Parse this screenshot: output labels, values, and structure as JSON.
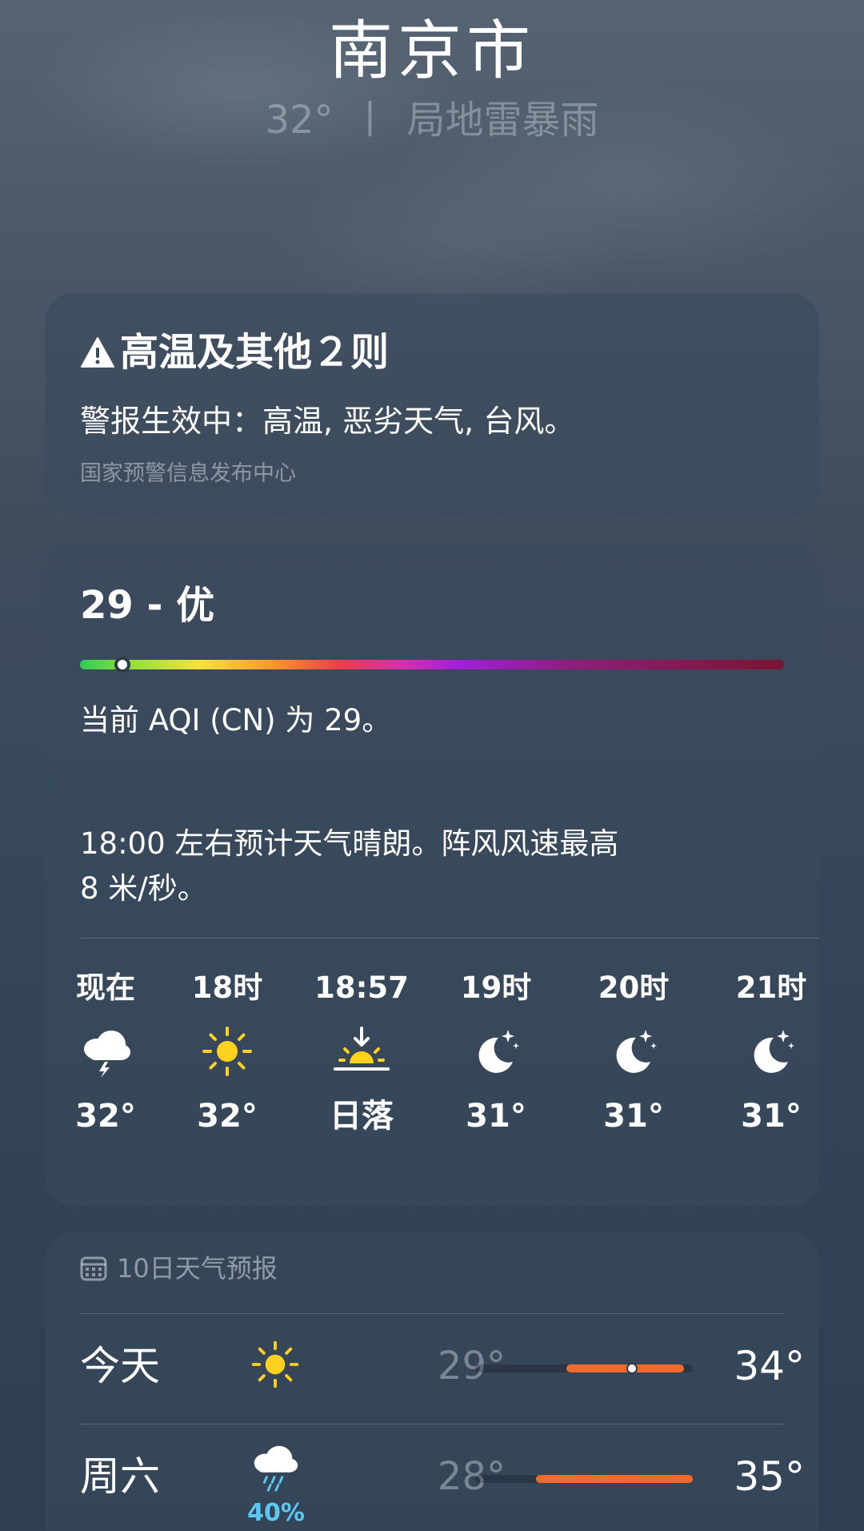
{
  "header": {
    "city": "南京市",
    "temp": "32°",
    "separator": "丨",
    "condition": "局地雷暴雨"
  },
  "alert": {
    "icon": "warning-triangle-icon",
    "title": "高温及其他２则",
    "body": "警报生效中：高温, 恶劣天气, 台风。",
    "source": "国家预警信息发布中心"
  },
  "aqi": {
    "headline": "29 - 优",
    "value": 29,
    "scale_max": 500,
    "description": "当前 AQI (CN) 为 29。"
  },
  "summary": {
    "line1": "18:00 左右预计天气晴朗。阵风风速最高",
    "line2": " 8 米/秒。"
  },
  "hourly": [
    {
      "time": "现在",
      "icon": "thunderstorm-cloud-icon",
      "temp": "32°"
    },
    {
      "time": "18时",
      "icon": "sun-icon",
      "temp": "32°"
    },
    {
      "time": "18:57",
      "icon": "sunset-icon",
      "temp": "日落"
    },
    {
      "time": "19时",
      "icon": "moon-stars-icon",
      "temp": "31°"
    },
    {
      "time": "20时",
      "icon": "moon-stars-icon",
      "temp": "31°"
    },
    {
      "time": "21时",
      "icon": "moon-stars-icon",
      "temp": "31°"
    }
  ],
  "forecast": {
    "icon": "calendar-icon",
    "title": "10日天气预报",
    "days": [
      {
        "day": "今天",
        "icon": "sun-icon",
        "low": "29°",
        "high": "34°",
        "range_start": 0.42,
        "range_end": 0.96,
        "current": 0.72
      },
      {
        "day": "周六",
        "icon": "rain-cloud-icon",
        "pop": "40%",
        "low": "28°",
        "high": "35°",
        "range_start": 0.28,
        "range_end": 1.0
      }
    ]
  },
  "colors": {
    "accent_orange": "#f26b2c",
    "precip_blue": "#5ec8f4",
    "sun_yellow": "#ffd21f"
  }
}
